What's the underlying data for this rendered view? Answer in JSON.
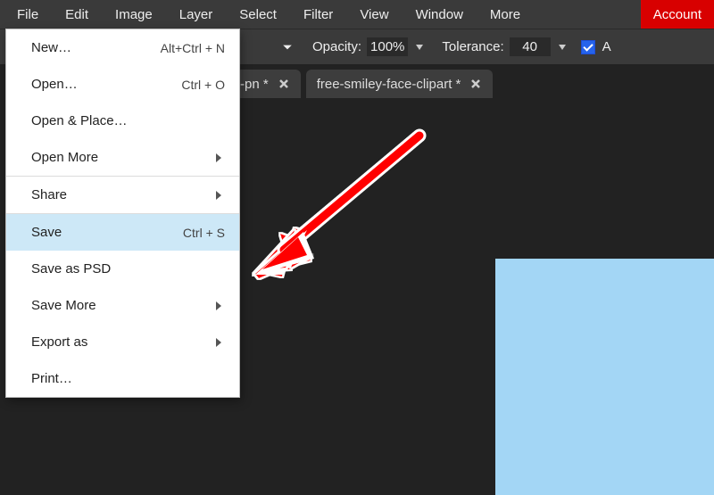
{
  "menubar": {
    "items": [
      "File",
      "Edit",
      "Image",
      "Layer",
      "Select",
      "Filter",
      "View",
      "Window",
      "More"
    ],
    "account": "Account"
  },
  "toolbar": {
    "opacity_label": "Opacity:",
    "opacity_value": "100%",
    "tolerance_label": "Tolerance:",
    "tolerance_value": "40",
    "trailing_letter": "A"
  },
  "tabs": [
    {
      "label": "-pn *"
    },
    {
      "label": "free-smiley-face-clipart *"
    }
  ],
  "file_menu": {
    "items": [
      {
        "label": "New…",
        "shortcut": "Alt+Ctrl + N",
        "submenu": false
      },
      {
        "label": "Open…",
        "shortcut": "Ctrl + O",
        "submenu": false
      },
      {
        "label": "Open & Place…",
        "shortcut": "",
        "submenu": false
      },
      {
        "label": "Open More",
        "shortcut": "",
        "submenu": true,
        "sep_after": true
      },
      {
        "label": "Share",
        "shortcut": "",
        "submenu": true,
        "sep_after": true
      },
      {
        "label": "Save",
        "shortcut": "Ctrl + S",
        "submenu": false,
        "highlight": true
      },
      {
        "label": "Save as PSD",
        "shortcut": "",
        "submenu": false
      },
      {
        "label": "Save More",
        "shortcut": "",
        "submenu": true
      },
      {
        "label": "Export as",
        "shortcut": "",
        "submenu": true
      },
      {
        "label": "Print…",
        "shortcut": "",
        "submenu": false
      }
    ]
  },
  "colors": {
    "accent_red": "#d80000",
    "highlight": "#cde8f7",
    "canvas_doc": "#a3d6f5",
    "arrow": "#ff0000"
  }
}
